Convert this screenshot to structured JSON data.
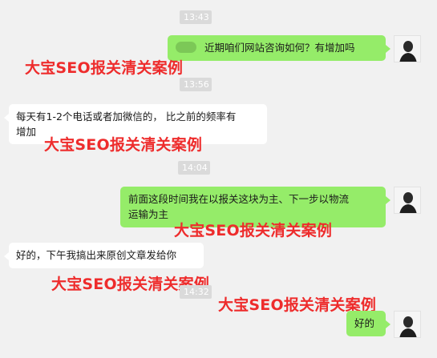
{
  "timestamps": [
    "13:43",
    "13:56",
    "14:04",
    "14:32"
  ],
  "messages": [
    {
      "text": "近期咱们网站咨询如何？有增加吗"
    },
    {
      "line1": "每天有1-2个电话或者加微信的， 比之前的频率有",
      "line2": "增加"
    },
    {
      "line1": "前面这段时间我在以报关这块为主、下一步以物流",
      "line2": "运输为主"
    },
    {
      "text": "好的，下午我搞出来原创文章发给你"
    },
    {
      "text": "好的"
    }
  ],
  "watermark": "大宝SEO报关清关案例",
  "colors": {
    "background": "#f1f1f1",
    "outgoing_bubble": "#95ec69",
    "incoming_bubble": "#ffffff",
    "watermark": "#ee2c2c",
    "timestamp_bg": "#dadada"
  }
}
